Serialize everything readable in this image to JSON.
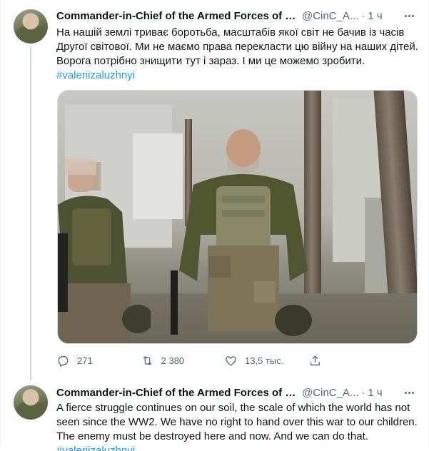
{
  "tweets": [
    {
      "author_name": "Commander-in-Chief of the Armed Forces of Ukr...",
      "handle": "@CinC_A...",
      "time": "1 ч",
      "text": "На нашій землі триває боротьба, масштабів якої світ не бачив із часів Другої світової. Ми не маємо права перекласти цю війну на наших дітей. Ворога потрібно знищити тут і зараз. І ми це можемо зробити.",
      "hashtag": "#valeriizaluzhnyi",
      "actions": {
        "reply_count": "271",
        "retweet_count": "2 380",
        "like_count": "13,5 тыс."
      }
    },
    {
      "author_name": "Commander-in-Chief of the Armed Forces of Ukr...",
      "handle": "@CinC_A...",
      "time": "1 ч",
      "text": "A fierce struggle continues on our soil, the scale of which the world has not seen since the WW2. We have no right to hand over this war to our children. The enemy must be destroyed here and now. And we can do that.",
      "hashtag": "#valeriizaluzhnyi"
    }
  ],
  "icons": {
    "more": "more-icon",
    "reply": "reply-icon",
    "retweet": "retweet-icon",
    "like": "like-icon",
    "share": "share-icon"
  },
  "colors": {
    "link": "#1d9bf0",
    "secondary_text": "#536471",
    "primary_text": "#0f1419",
    "thread_line": "#cfd9de"
  }
}
